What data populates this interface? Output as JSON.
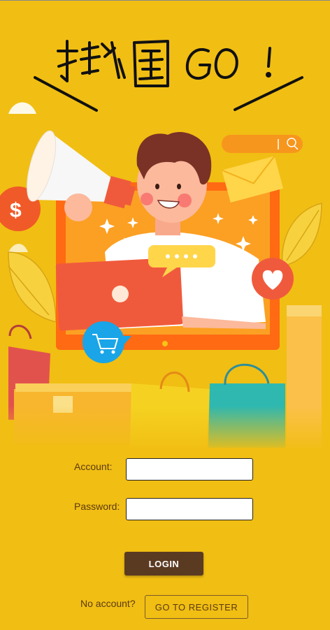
{
  "banner": {
    "title_text": "揪團GO!",
    "illustration": "shopping-promo-illustration"
  },
  "login_form": {
    "account_label": "Account:",
    "account_value": "",
    "password_label": "Password:",
    "password_value": "",
    "login_button_label": "LOGIN"
  },
  "register": {
    "prompt_text": "No account?",
    "button_label": "GO TO REGISTER"
  },
  "colors": {
    "background": "#F1BE13",
    "login_button": "#5B3A22"
  }
}
